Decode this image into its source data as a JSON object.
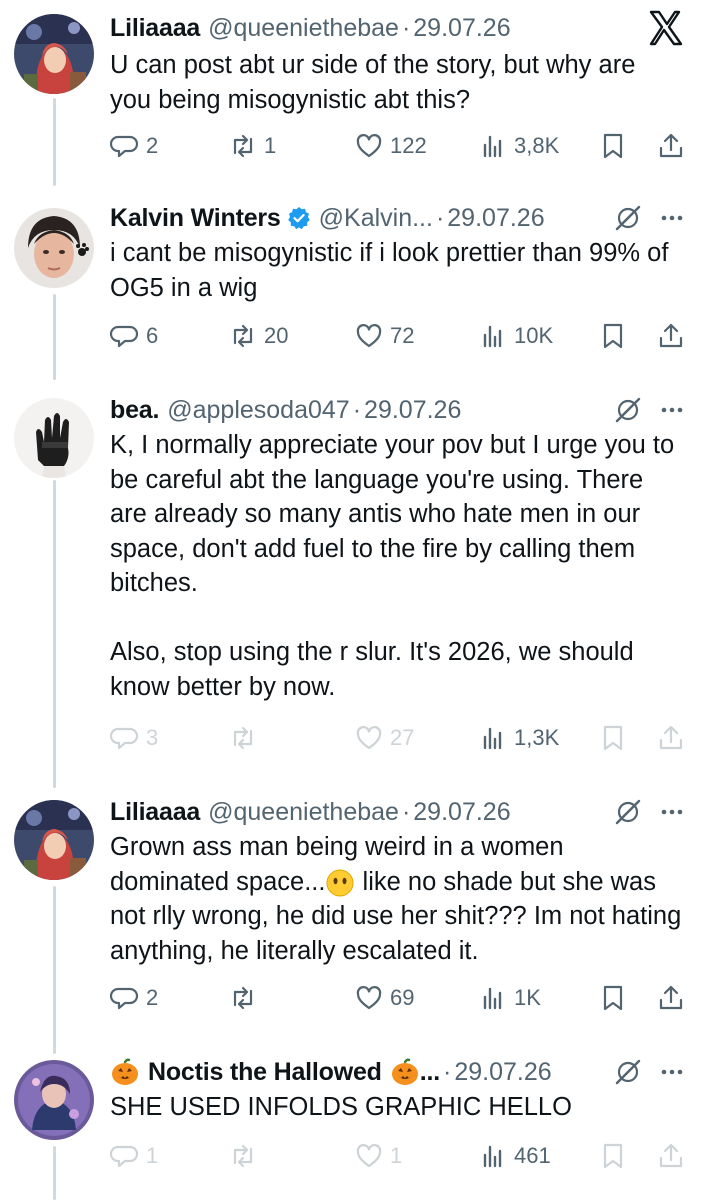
{
  "tweets": [
    {
      "name": "Liliaaaa",
      "handle": "@queeniethebae",
      "date": "29.07.26",
      "text": "U can post abt ur side of the story, but why are you being misogynistic abt this?",
      "replies": "2",
      "reposts": "1",
      "likes": "122",
      "views": "3,8K"
    },
    {
      "name": "Kalvin Winters",
      "handle": "@Kalvin...",
      "date": "29.07.26",
      "text": "i cant be misogynistic if i look prettier than 99% of OG5 in a wig",
      "replies": "6",
      "reposts": "20",
      "likes": "72",
      "views": "10K"
    },
    {
      "name": "bea.",
      "handle": "@applesoda047",
      "date": "29.07.26",
      "text": "K, I normally appreciate your pov but I urge you to be careful abt the language you're using. There are already so many antis who hate men in our space, don't add fuel to the fire by calling them bitches.\n\nAlso, stop using the r slur. It's 2026, we should know better by now.",
      "replies": "3",
      "reposts": "",
      "likes": "27",
      "views": "1,3K"
    },
    {
      "name": "Liliaaaa",
      "handle": "@queeniethebae",
      "date": "29.07.26",
      "text_before": "Grown ass man being weird in a women dominated space...",
      "text_after": " like no shade but she was not rlly wrong, he did use her shit??? Im not hating anything, he literally escalated it.",
      "replies": "2",
      "reposts": "",
      "likes": "69",
      "views": "1K"
    },
    {
      "name": "Noctis the Hallowed",
      "name_suffix": "...",
      "date": "29.07.26",
      "text": "SHE USED INFOLDS GRAPHIC HELLO",
      "replies": "1",
      "reposts": "",
      "likes": "1",
      "views": "461"
    }
  ],
  "separator": "·",
  "icons": {
    "app_logo": "x-logo-icon",
    "reply": "reply-icon",
    "repost": "repost-icon",
    "like": "heart-icon",
    "views": "views-icon",
    "bookmark": "bookmark-icon",
    "share": "share-icon",
    "grok": "grok-icon",
    "more": "more-icon",
    "verified": "verified-badge-icon",
    "emoji_face": "face-without-mouth-emoji",
    "emoji_pumpkin": "jack-o-lantern-emoji"
  },
  "colors": {
    "text": "#0f1419",
    "secondary": "#536471",
    "verified": "#1d9bf0",
    "thread_line": "#cfd9de",
    "background": "#ffffff"
  }
}
